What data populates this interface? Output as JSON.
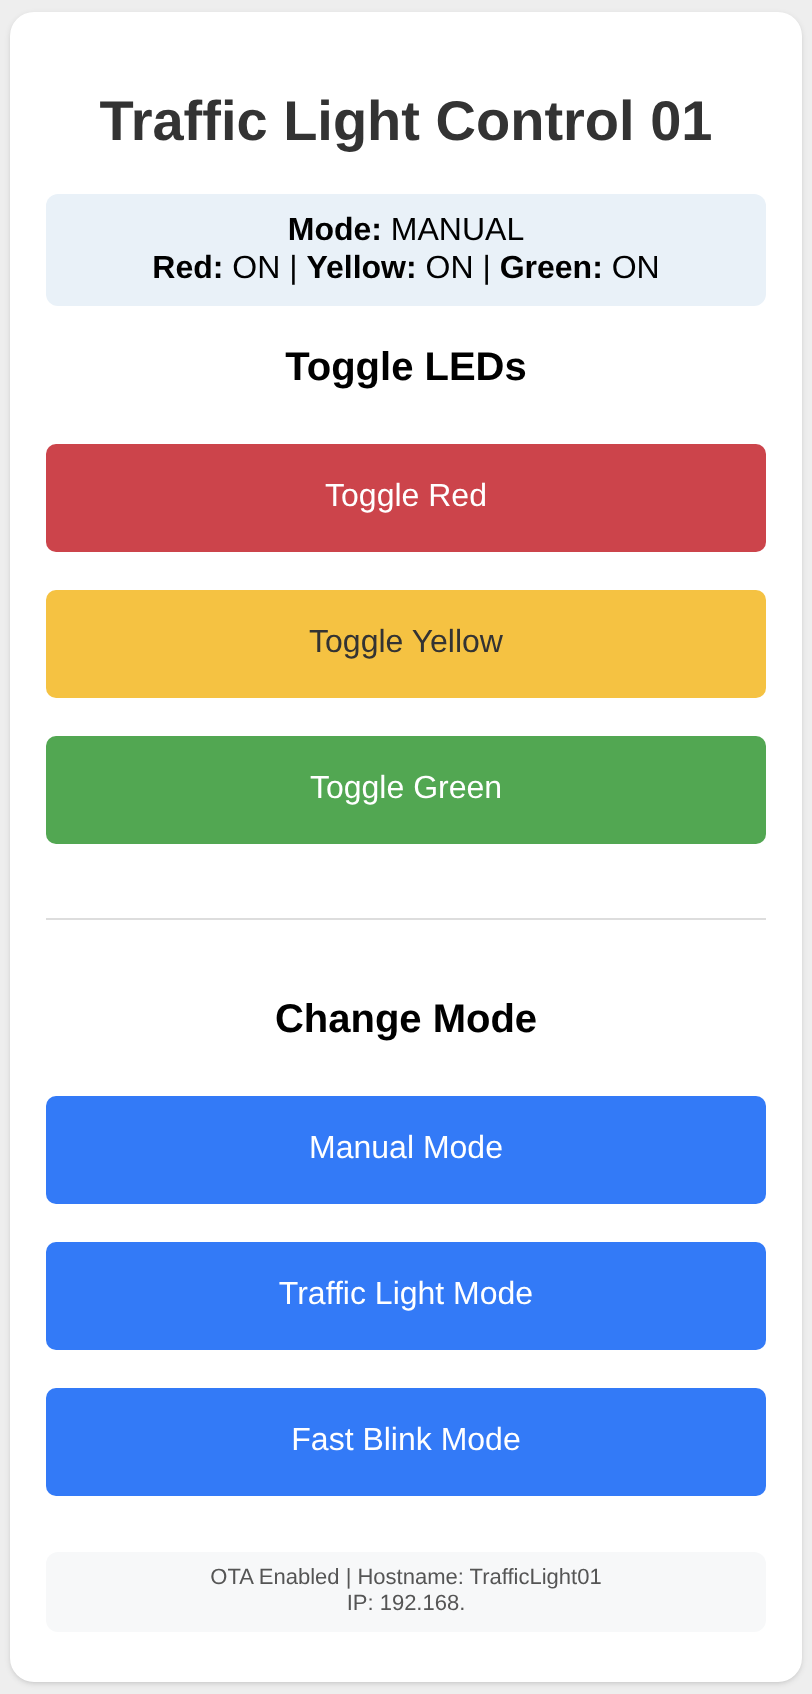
{
  "title": "Traffic Light Control 01",
  "status": {
    "lines": [
      "**Mode:** MANUAL",
      "**Red:** ON | **Yellow:** ON | **Green:** ON"
    ]
  },
  "led_section": {
    "heading": "Toggle LEDs",
    "buttons": [
      {
        "label": "Toggle Red",
        "color": "#cc444b"
      },
      {
        "label": "Toggle Yellow",
        "color": "#f5c242"
      },
      {
        "label": "Toggle Green",
        "color": "#52a752"
      }
    ]
  },
  "mode_section": {
    "heading": "Change Mode",
    "buttons": [
      {
        "label": "Manual Mode",
        "color": "#337af7"
      },
      {
        "label": "Traffic Light Mode",
        "color": "#337af7"
      },
      {
        "label": "Fast Blink Mode",
        "color": "#337af7"
      }
    ]
  },
  "footer": {
    "lines": [
      "OTA Enabled | Hostname: TrafficLight01",
      "IP: 192.168."
    ]
  }
}
